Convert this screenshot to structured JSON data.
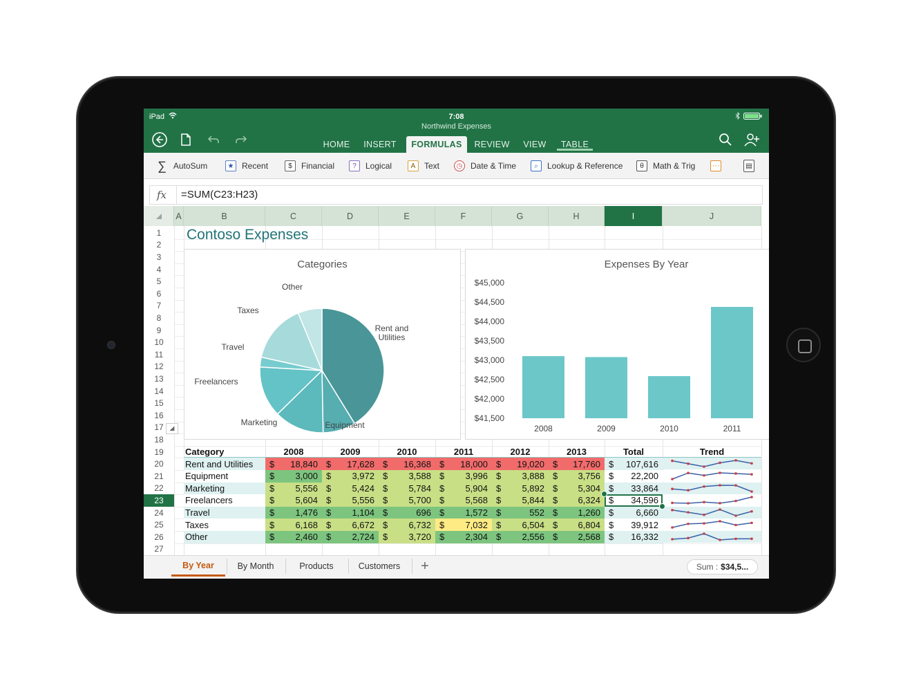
{
  "status": {
    "device": "iPad",
    "time": "7:08"
  },
  "document": {
    "title": "Northwind Expenses"
  },
  "tabs": [
    "HOME",
    "INSERT",
    "FORMULAS",
    "REVIEW",
    "VIEW",
    "TABLE"
  ],
  "active_tab": "FORMULAS",
  "ribbon": [
    "AutoSum",
    "Recent",
    "Financial",
    "Logical",
    "Text",
    "Date & Time",
    "Lookup & Reference",
    "Math & Trig"
  ],
  "ribbon_icons": [
    "sum-icon",
    "star-icon",
    "financial-icon",
    "logical-icon",
    "text-icon",
    "clock-icon",
    "lookup-icon",
    "math-icon",
    "more-icon",
    "calculator-icon"
  ],
  "formula": {
    "fx": "fx",
    "text": "=SUM(C23:H23)"
  },
  "columns": [
    "A",
    "B",
    "C",
    "D",
    "E",
    "F",
    "G",
    "H",
    "I",
    "J"
  ],
  "selected_column": "I",
  "rows": [
    "1",
    "2",
    "3",
    "4",
    "5",
    "6",
    "7",
    "8",
    "9",
    "10",
    "11",
    "12",
    "13",
    "14",
    "15",
    "16",
    "17",
    "18",
    "19",
    "20",
    "21",
    "22",
    "23",
    "24",
    "25",
    "26",
    "27"
  ],
  "selected_row": "23",
  "sheet_title": "Contoso Expenses",
  "charts": [
    {
      "type": "pie",
      "title": "Categories",
      "categories": [
        "Rent and Utilities",
        "Equipment",
        "Marketing",
        "Freelancers",
        "Travel",
        "Taxes",
        "Other"
      ],
      "values": [
        107616,
        22200,
        33864,
        34596,
        6660,
        39912,
        16332
      ],
      "label_lines": [
        [
          "Rent and",
          "Utilities"
        ],
        [
          "Equipment"
        ],
        [
          "Marketing"
        ],
        [
          "Freelancers"
        ],
        [
          "Travel"
        ],
        [
          "Taxes"
        ],
        [
          "Other"
        ]
      ]
    },
    {
      "type": "bar",
      "title": "Expenses By Year",
      "categories": [
        "2008",
        "2009",
        "2010",
        "2011"
      ],
      "values": [
        43104,
        43080,
        42588,
        44376
      ],
      "yticks": [
        "$45,000",
        "$44,500",
        "$44,000",
        "$43,500",
        "$43,000",
        "$42,500",
        "$42,000",
        "$41,500"
      ],
      "ylim": [
        41500,
        45000
      ]
    }
  ],
  "table": {
    "headers": [
      "Category",
      "2008",
      "2009",
      "2010",
      "2011",
      "2012",
      "2013",
      "Total",
      "Trend"
    ],
    "currency": "$",
    "rows": [
      {
        "category": "Rent and Utilities",
        "values": [
          "18,840",
          "17,628",
          "16,368",
          "18,000",
          "19,020",
          "17,760"
        ],
        "total": "107,616",
        "raw": [
          18840,
          17628,
          16368,
          18000,
          19020,
          17760
        ]
      },
      {
        "category": "Equipment",
        "values": [
          "3,000",
          "3,972",
          "3,588",
          "3,996",
          "3,888",
          "3,756"
        ],
        "total": "22,200",
        "raw": [
          3000,
          3972,
          3588,
          3996,
          3888,
          3756
        ]
      },
      {
        "category": "Marketing",
        "values": [
          "5,556",
          "5,424",
          "5,784",
          "5,904",
          "5,892",
          "5,304"
        ],
        "total": "33,864",
        "raw": [
          5556,
          5424,
          5784,
          5904,
          5892,
          5304
        ]
      },
      {
        "category": "Freelancers",
        "values": [
          "5,604",
          "5,556",
          "5,700",
          "5,568",
          "5,844",
          "6,324"
        ],
        "total": "34,596",
        "raw": [
          5604,
          5556,
          5700,
          5568,
          5844,
          6324
        ]
      },
      {
        "category": "Travel",
        "values": [
          "1,476",
          "1,104",
          "696",
          "1,572",
          "552",
          "1,260"
        ],
        "total": "6,660",
        "raw": [
          1476,
          1104,
          696,
          1572,
          552,
          1260
        ]
      },
      {
        "category": "Taxes",
        "values": [
          "6,168",
          "6,672",
          "6,732",
          "7,032",
          "6,504",
          "6,804"
        ],
        "total": "39,912",
        "raw": [
          6168,
          6672,
          6732,
          7032,
          6504,
          6804
        ]
      },
      {
        "category": "Other",
        "values": [
          "2,460",
          "2,724",
          "3,720",
          "2,304",
          "2,556",
          "2,568"
        ],
        "total": "16,332",
        "raw": [
          2460,
          2724,
          3720,
          2304,
          2556,
          2568
        ]
      }
    ],
    "colors": {
      "high": "#f26b6b",
      "mid_high": "#fbd87f",
      "mid": "#ffeb84",
      "mid_low": "#c9df86",
      "low": "#7dc57f"
    }
  },
  "sheet_tabs": [
    "By Year",
    "By Month",
    "Products",
    "Customers"
  ],
  "active_sheet": "By Year",
  "add_sheet": "+",
  "sum": {
    "label": "Sum :",
    "value": "$34,5..."
  },
  "theme": {
    "green": "#217346",
    "teal": "#6cc7c9",
    "title_teal": "#217375"
  }
}
